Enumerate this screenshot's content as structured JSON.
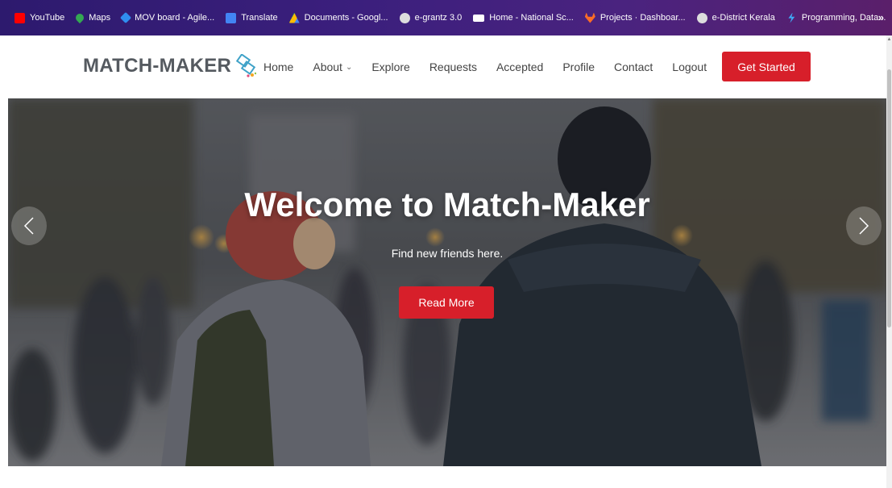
{
  "bookmarks": [
    {
      "label": "YouTube",
      "icon": "youtube-icon",
      "color": "#ff0000"
    },
    {
      "label": "Maps",
      "icon": "maps-icon",
      "color": "#34a853"
    },
    {
      "label": "MOV board - Agile...",
      "icon": "diamond-icon",
      "color": "#2f8ef0"
    },
    {
      "label": "Translate",
      "icon": "translate-icon",
      "color": "#4285f4"
    },
    {
      "label": "Documents - Googl...",
      "icon": "drive-icon",
      "color": "#fbbc04"
    },
    {
      "label": "e-grantz 3.0",
      "icon": "globe-icon",
      "color": "#dddddd"
    },
    {
      "label": "Home - National Sc...",
      "icon": "nsc-icon",
      "color": "#ffffff"
    },
    {
      "label": "Projects · Dashboar...",
      "icon": "gitlab-icon",
      "color": "#fc6d26"
    },
    {
      "label": "e-District Kerala",
      "icon": "globe-icon",
      "color": "#dddddd"
    },
    {
      "label": "Programming, Data...",
      "icon": "bolt-icon",
      "color": "#3fa9f5"
    }
  ],
  "bookmarks_more": "»",
  "navbar": {
    "logo": "MATCH-MAKER",
    "items": [
      "Home",
      "About",
      "Explore",
      "Requests",
      "Accepted",
      "Profile",
      "Contact",
      "Logout"
    ],
    "cta": "Get Started"
  },
  "hero": {
    "title": "Welcome to Match-Maker",
    "subtitle": "Find new friends here.",
    "button": "Read More"
  },
  "colors": {
    "accent": "#d71f2a",
    "logo": "#555a60"
  }
}
